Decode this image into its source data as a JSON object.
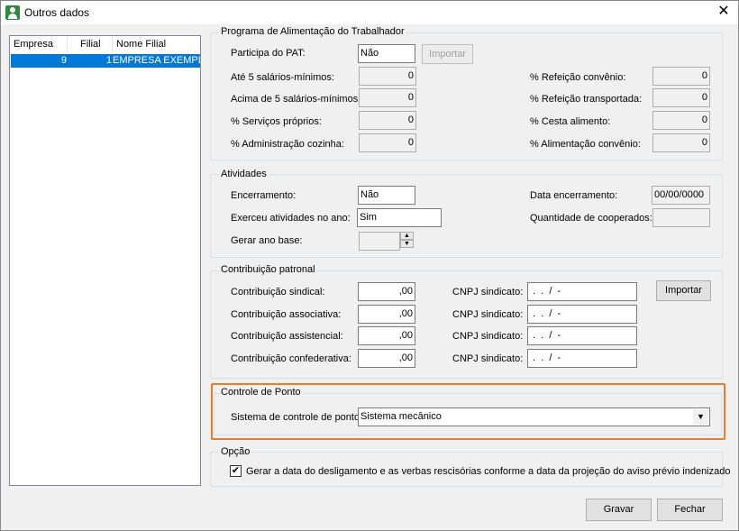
{
  "window": {
    "title": "Outros dados",
    "close_glyph": "✕"
  },
  "list": {
    "columns": [
      "Empresa",
      "Filial",
      "Nome Filial"
    ],
    "rows": [
      {
        "empresa": "9",
        "filial": "1",
        "nome": "EMPRESA EXEMPL"
      }
    ]
  },
  "pat": {
    "title": "Programa de Alimentação do Trabalhador",
    "participa_label": "Participa do PAT:",
    "participa_value": "Não",
    "import_label": "Importar",
    "left": [
      {
        "label": "Até 5 salários-mínimos:",
        "value": "0"
      },
      {
        "label": "Acima de 5 salários-mínimos:",
        "value": "0"
      },
      {
        "label": "% Serviços próprios:",
        "value": "0"
      },
      {
        "label": "% Administração cozinha:",
        "value": "0"
      }
    ],
    "right": [
      {
        "label": "% Refeição convênio:",
        "value": "0"
      },
      {
        "label": "% Refeição transportada:",
        "value": "0"
      },
      {
        "label": "% Cesta alimento:",
        "value": "0"
      },
      {
        "label": "% Alimentação convênio:",
        "value": "0"
      }
    ]
  },
  "atividades": {
    "title": "Atividades",
    "encerramento_label": "Encerramento:",
    "encerramento_value": "Não",
    "data_label": "Data encerramento:",
    "data_value": "00/00/0000",
    "exerceu_label": "Exerceu atividades no ano:",
    "exerceu_value": "Sim",
    "cooperados_label": "Quantidade de cooperados:",
    "cooperados_value": "",
    "ano_base_label": "Gerar ano base:",
    "ano_base_value": ""
  },
  "contribuicao": {
    "title": "Contribuição patronal",
    "import_label": "Importar",
    "rows": [
      {
        "label": "Contribuição sindical:",
        "value": ",00",
        "cnpj_label": "CNPJ sindicato:",
        "cnpj_value": " .  .  /  -"
      },
      {
        "label": "Contribuição associativa:",
        "value": ",00",
        "cnpj_label": "CNPJ sindicato:",
        "cnpj_value": " .  .  /  -"
      },
      {
        "label": "Contribuição assistencial:",
        "value": ",00",
        "cnpj_label": "CNPJ sindicato:",
        "cnpj_value": " .  .  /  -"
      },
      {
        "label": "Contribuição confederativa:",
        "value": ",00",
        "cnpj_label": "CNPJ sindicato:",
        "cnpj_value": " .  .  /  -"
      }
    ]
  },
  "ponto": {
    "title": "Controle de Ponto",
    "label": "Sistema de controle de ponto:",
    "value": "Sistema mecânico",
    "highlight_color": "#f07a26"
  },
  "opcao": {
    "title": "Opção",
    "checkbox_label": "Gerar a data do desligamento e as verbas rescisórias conforme a data da projeção do aviso prévio indenizado",
    "checked": true,
    "check_glyph": "✔"
  },
  "footer": {
    "save_label": "Gravar",
    "close_label": "Fechar"
  }
}
